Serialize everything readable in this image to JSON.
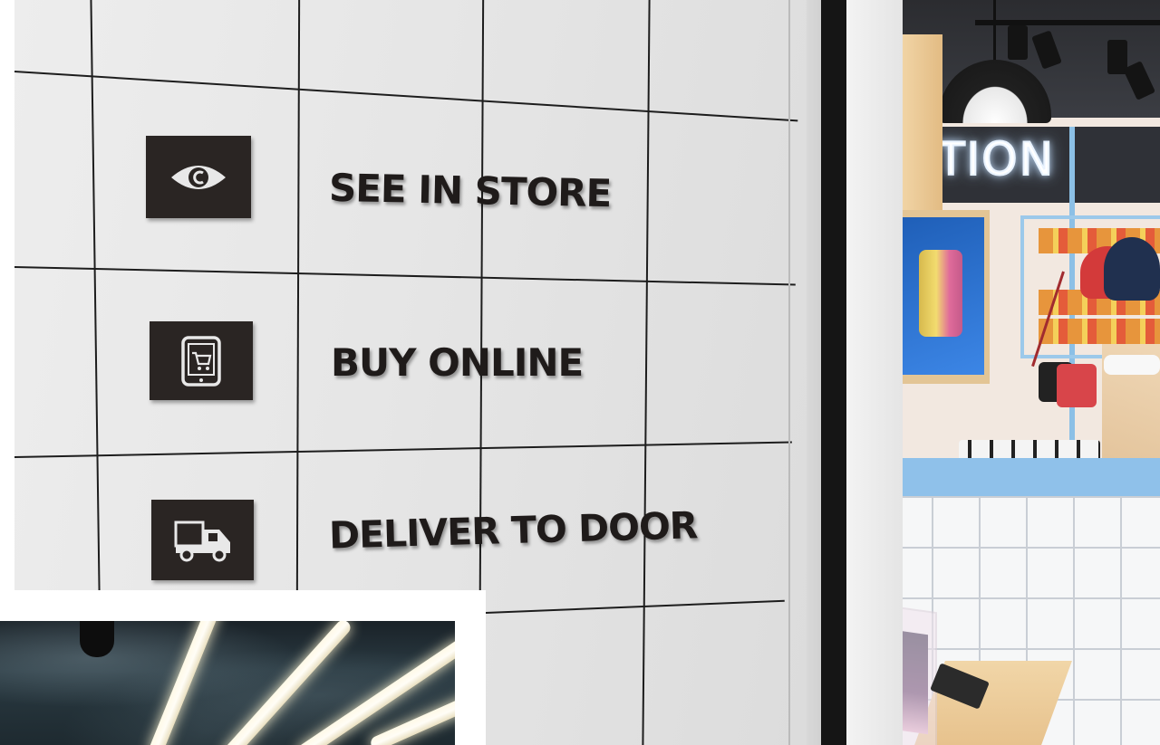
{
  "signage": {
    "items": [
      {
        "label": "SEE IN STORE",
        "icon": "eye-icon"
      },
      {
        "label": "BUY ONLINE",
        "icon": "tablet-cart-icon"
      },
      {
        "label": "DELIVER TO DOOR",
        "icon": "delivery-truck-icon"
      }
    ]
  },
  "storefront": {
    "neon_sign": "TION"
  },
  "colors": {
    "sign_text": "#1f1b1a",
    "icon_tile": "#2a2523",
    "wall": "#e6e6e6",
    "counter_blue": "#8fc1ea"
  }
}
